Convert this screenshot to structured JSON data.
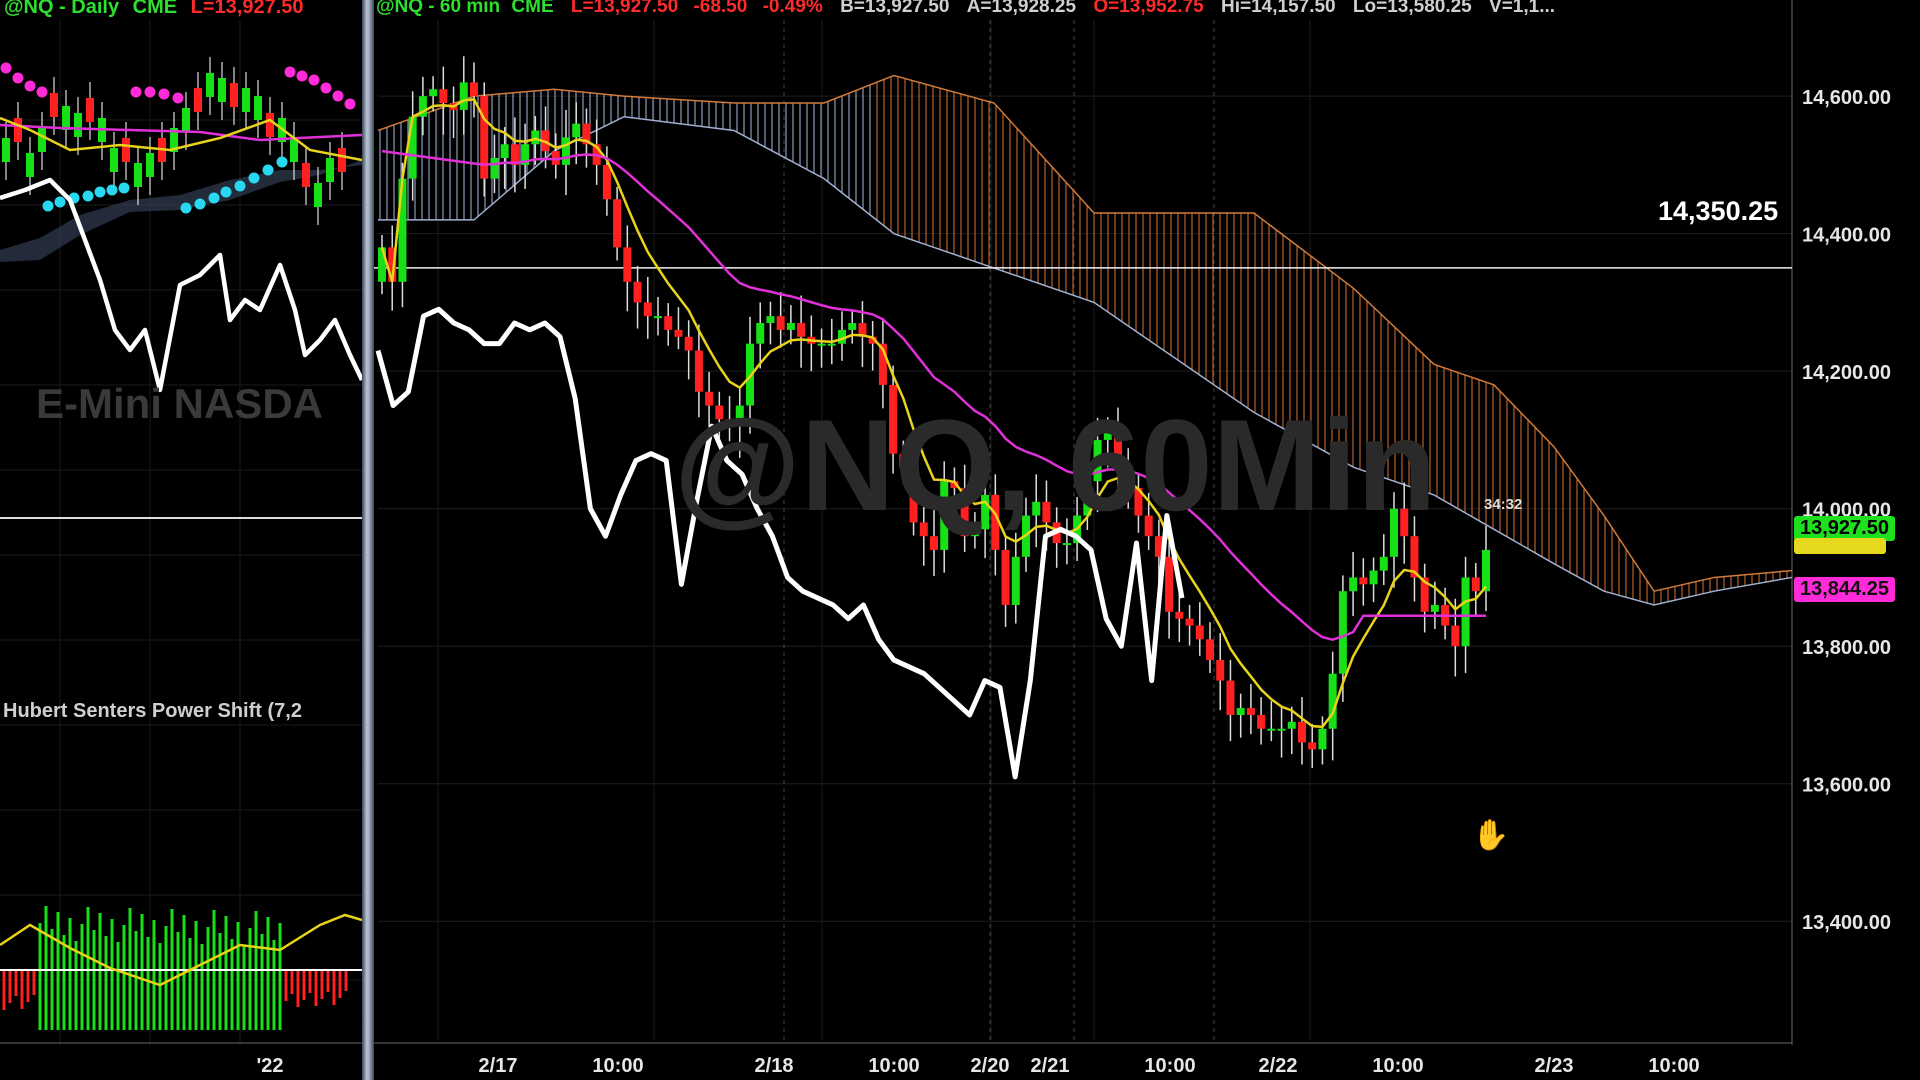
{
  "left_chart": {
    "symbol_label": "@NQ - Daily",
    "exchange_label": "CME",
    "last_label": "L=13,927.50",
    "watermark": "E-Mini NASDA",
    "indicator_title": "Hubert Senters Power Shift (7,2",
    "x_tick": "'22"
  },
  "main_chart": {
    "header": {
      "symbol_label": "@NQ - 60 min",
      "exchange_label": "CME",
      "last_label": "L=13,927.50",
      "change_label": "-68.50",
      "pct_label": "-0.49%",
      "bid_label": "B=13,927.50",
      "ask_label": "A=13,928.25",
      "open_label": "O=13,952.75",
      "high_label": "Hi=14,157.50",
      "low_label": "Lo=13,580.25",
      "vol_label": "V=1,1..."
    },
    "watermark": "@NQ, 60Min",
    "hline_label": "14,350.25",
    "countdown": "34:32",
    "last_price_tag": "13,927.50",
    "ma_price_tag": "13,844.25",
    "colors": {
      "up": "#17e017",
      "down": "#ff2020",
      "cloud_bull": "#aab8d8",
      "cloud_bear": "#d07a3a",
      "fast_ma": "#e8d21a",
      "slow_ma": "#e030d8",
      "line": "#ffffff"
    }
  },
  "chart_data": [
    {
      "type": "candlestick",
      "name": "@NQ 60 min",
      "yaxis": {
        "ticks": [
          13400,
          13600,
          13800,
          14000,
          14200,
          14400,
          14600
        ],
        "labels": [
          "13,400.00",
          "13,600.00",
          "13,800.00",
          "14,000.00",
          "14,200.00",
          "14,400.00",
          "14,600.00"
        ],
        "range": [
          13220,
          14670
        ]
      },
      "xaxis": {
        "labels": [
          "2/17",
          "10:00",
          "2/18",
          "10:00",
          "2/20",
          "2/21",
          "10:00",
          "2/22",
          "10:00",
          "2/23",
          "10:00"
        ]
      },
      "grid": true,
      "close": [
        14380,
        14330,
        14480,
        14570,
        14600,
        14610,
        14590,
        14580,
        14620,
        14600,
        14480,
        14510,
        14530,
        14500,
        14530,
        14550,
        14520,
        14500,
        14540,
        14560,
        14530,
        14500,
        14450,
        14380,
        14330,
        14300,
        14280,
        14280,
        14260,
        14250,
        14230,
        14170,
        14150,
        14130,
        14120,
        14150,
        14240,
        14270,
        14280,
        14260,
        14270,
        14250,
        14240,
        14240,
        14240,
        14260,
        14270,
        14250,
        14240,
        14180,
        14080,
        14060,
        13980,
        13960,
        13940,
        14040,
        14030,
        13960,
        13970,
        14020,
        13940,
        13860,
        13930,
        13990,
        14010,
        13980,
        13950,
        13950,
        13990,
        14040,
        14100,
        14110,
        14060,
        14030,
        13990,
        13960,
        13930,
        13850,
        13840,
        13830,
        13810,
        13780,
        13750,
        13700,
        13710,
        13700,
        13680,
        13680,
        13680,
        13690,
        13660,
        13650,
        13680,
        13760,
        13880,
        13900,
        13890,
        13910,
        13930,
        14000,
        13960,
        13900,
        13850,
        13860,
        13830,
        13800,
        13900,
        13880,
        13940
      ],
      "overlay_line": [
        14230,
        14150,
        14170,
        14280,
        14290,
        14270,
        14260,
        14240,
        14240,
        14270,
        14260,
        14270,
        14250,
        14160,
        14000,
        13960,
        14020,
        14070,
        14080,
        14070,
        13890,
        14010,
        14120,
        14070,
        14050,
        14000,
        13960,
        13900,
        13880,
        13870,
        13860,
        13840,
        13860,
        13810,
        13780,
        13770,
        13760,
        13740,
        13720,
        13700,
        13750,
        13740,
        13610,
        13750,
        13960,
        13970,
        13960,
        13940,
        13840,
        13800,
        13950,
        13750,
        13990,
        13870
      ],
      "horizontal_level": 14350.25,
      "last": 13927.5,
      "slow_ma_last": 13844.25
    },
    {
      "type": "candlestick",
      "name": "@NQ Daily",
      "last": 13927.5,
      "xaxis": {
        "labels": [
          "'22"
        ]
      }
    }
  ]
}
